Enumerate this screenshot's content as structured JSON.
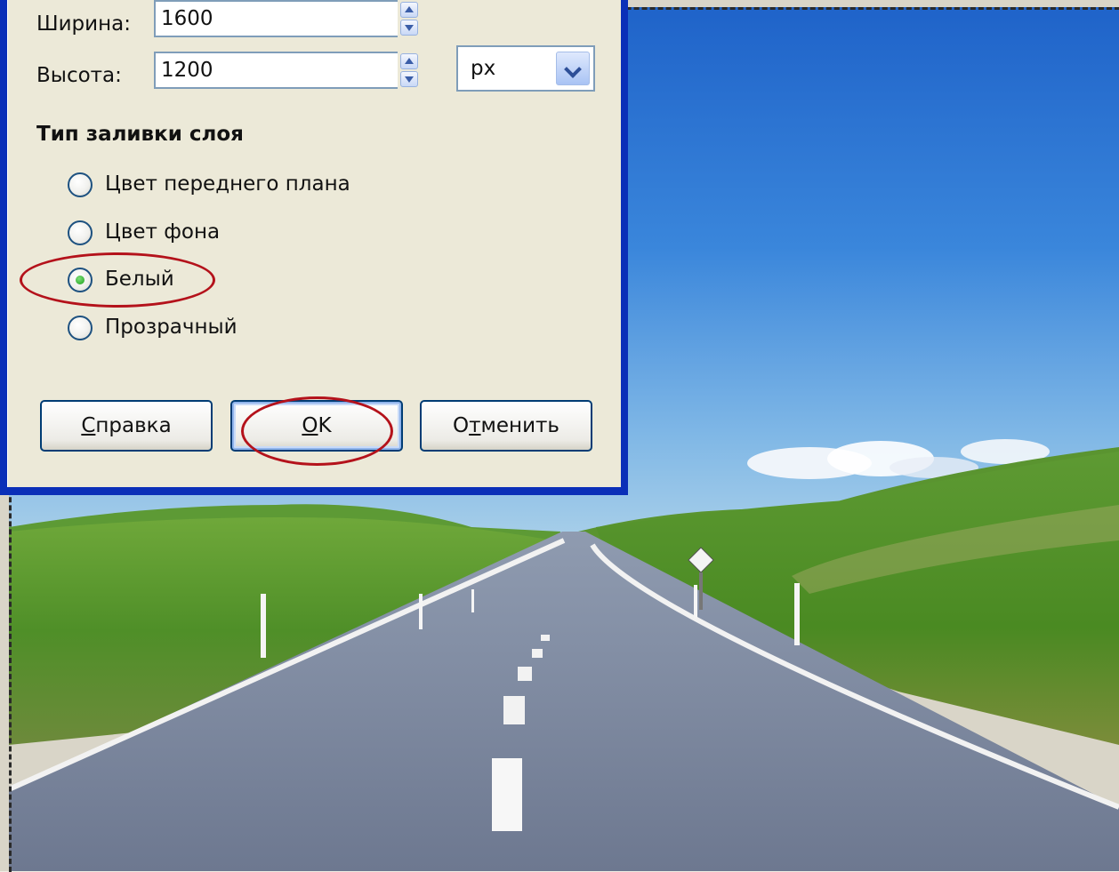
{
  "dialog": {
    "width_label": "Ширина:",
    "width_value": "1600",
    "height_label": "Высота:",
    "height_value": "1200",
    "unit": "px",
    "fill_section_title": "Тип заливки слоя",
    "fill_options": [
      {
        "label": "Цвет переднего плана",
        "checked": false
      },
      {
        "label": "Цвет фона",
        "checked": false
      },
      {
        "label": "Белый",
        "checked": true
      },
      {
        "label": "Прозрачный",
        "checked": false
      }
    ],
    "buttons": {
      "help_first": "С",
      "help_rest": "правка",
      "ok_first": "O",
      "ok_rest": "K",
      "cancel_a": "О",
      "cancel_u": "т",
      "cancel_rest": "менить"
    }
  },
  "colors": {
    "dialog_frame": "#0a2fb8",
    "dialog_bg": "#ece9d8",
    "highlight_ellipse": "#b4121b",
    "radio_checked": "#1a9e1a"
  },
  "icons": [
    "spin-up-icon",
    "spin-down-icon",
    "dropdown-arrow-icon"
  ]
}
